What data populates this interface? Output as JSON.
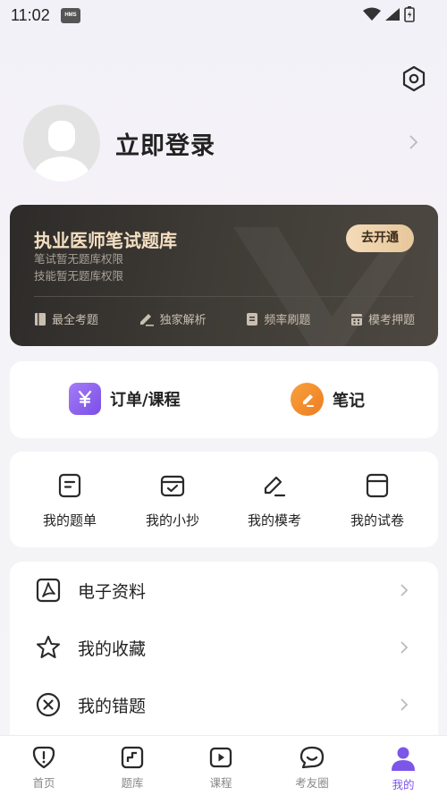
{
  "status_bar": {
    "time": "11:02",
    "badge": "HMS"
  },
  "profile": {
    "login_text": "立即登录"
  },
  "vip_card": {
    "title": "执业医师笔试题库",
    "line1": "笔试暂无题库权限",
    "line2": "技能暂无题库权限",
    "button": "去开通",
    "features": [
      "最全考题",
      "独家解析",
      "频率刷题",
      "模考押题"
    ]
  },
  "orders": {
    "order_label": "订单/课程",
    "notes_label": "笔记",
    "order_color": "#8a5cf0",
    "notes_color": "#f08a2c"
  },
  "mine": {
    "items": [
      "我的题单",
      "我的小抄",
      "我的模考",
      "我的试卷"
    ]
  },
  "list": {
    "items": [
      "电子资料",
      "我的收藏",
      "我的错题"
    ]
  },
  "bottom_nav": {
    "items": [
      "首页",
      "题库",
      "课程",
      "考友圈",
      "我的"
    ],
    "active": "我的",
    "active_color": "#7d55e8"
  }
}
